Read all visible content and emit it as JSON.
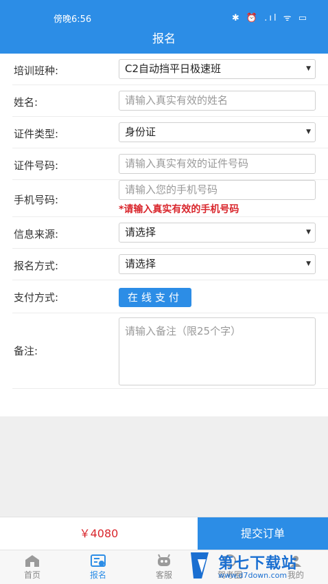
{
  "status": {
    "time": "傍晚6:56",
    "icons": "✱ ⏰ .ıl ᯤ ▭"
  },
  "title": "报名",
  "form": {
    "class_type": {
      "label": "培训班种:",
      "value": "C2自动挡平日极速班"
    },
    "name": {
      "label": "姓名:",
      "placeholder": "请输入真实有效的姓名"
    },
    "id_type": {
      "label": "证件类型:",
      "value": "身份证"
    },
    "id_number": {
      "label": "证件号码:",
      "placeholder": "请输入真实有效的证件号码"
    },
    "phone": {
      "label": "手机号码:",
      "placeholder": "请输入您的手机号码",
      "hint": "*请输入真实有效的手机号码"
    },
    "source": {
      "label": "信息来源:",
      "value": "请选择"
    },
    "method": {
      "label": "报名方式:",
      "value": "请选择"
    },
    "payment": {
      "label": "支付方式:",
      "button": "在线支付"
    },
    "remark": {
      "label": "备注:",
      "placeholder": "请输入备注（限25个字）"
    }
  },
  "footer": {
    "price": "￥4080",
    "submit": "提交订单"
  },
  "tabs": [
    {
      "label": "首页",
      "icon": "home-icon"
    },
    {
      "label": "报名",
      "icon": "signup-icon"
    },
    {
      "label": "客服",
      "icon": "robot-icon"
    },
    {
      "label": "驾考圈",
      "icon": "circle-icon"
    },
    {
      "label": "我的",
      "icon": "user-icon"
    }
  ],
  "watermark": {
    "title": "第七下载站",
    "url": "www.d7down.com"
  },
  "colors": {
    "primary": "#2c8de6",
    "warning": "#d9262c"
  }
}
